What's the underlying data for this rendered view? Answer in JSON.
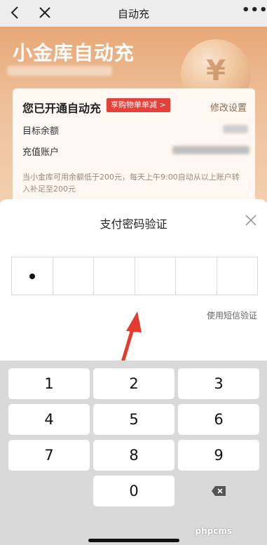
{
  "nav": {
    "title": "自动充",
    "more_label": "•••"
  },
  "hero": {
    "title": "小金库自动充",
    "coin_glyph": "¥"
  },
  "card": {
    "title": "您已开通自动充",
    "promo_tag": "享购物单单减 >",
    "modify_label": "修改设置",
    "target_label": "目标余额",
    "account_label": "充值账户",
    "note": "当小金库可用余额低于200元，每天上午9:00自动从以上账户转入补足至200元"
  },
  "modal": {
    "title": "支付密码验证",
    "sms_link": "使用短信验证",
    "pin_filled": 1,
    "pin_length": 6
  },
  "keypad": {
    "keys": [
      "1",
      "2",
      "3",
      "4",
      "5",
      "6",
      "7",
      "8",
      "9",
      "0"
    ],
    "watermark": "phpcms"
  },
  "colors": {
    "accent_red": "#e4413a",
    "hero_bg": "#e7a877"
  }
}
